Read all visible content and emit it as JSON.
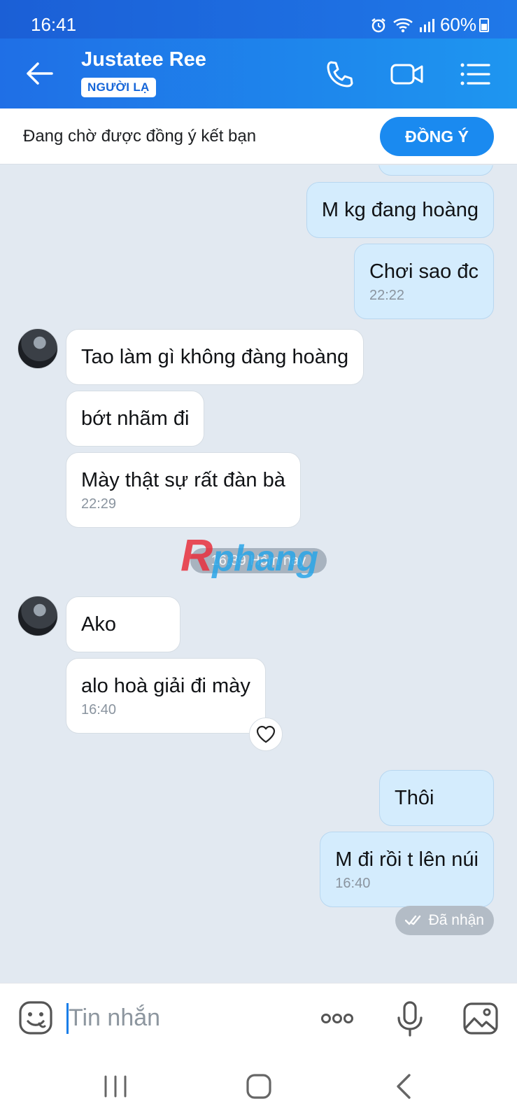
{
  "status_bar": {
    "time": "16:41",
    "battery": "60%"
  },
  "header": {
    "contact_name": "Justatee Ree",
    "badge": "NGƯỜI LẠ"
  },
  "friend_request": {
    "text": "Đang chờ được đồng ý kết bạn",
    "accept_label": "ĐỒNG Ý"
  },
  "messages": {
    "m1": {
      "text": "M kg đang hoàng"
    },
    "m2": {
      "text": "Chơi sao đc",
      "time": "22:22"
    },
    "m3": {
      "text": "Tao làm gì không đàng hoàng"
    },
    "m4": {
      "text": "bớt nhãm đi"
    },
    "m5": {
      "text": "Mày thật sự rất đàn bà",
      "time": "22:29"
    },
    "m6": {
      "text": "Ako"
    },
    "m7": {
      "text": "alo hoà giải đi mày",
      "time": "16:40"
    },
    "m8": {
      "text": "Thôi"
    },
    "m9": {
      "text": "M đi rồi t lên núi",
      "time": "16:40"
    }
  },
  "date_separator": "16:39 Hôm nay",
  "watermark": {
    "first": "R",
    "rest": "phang"
  },
  "receipt": {
    "label": "Đã nhận"
  },
  "composer": {
    "placeholder": "Tin nhắn"
  },
  "colors": {
    "header": "#1f78e8",
    "accent": "#1a8af0",
    "outgoing_bubble": "#d4ecfd",
    "incoming_bubble": "#ffffff",
    "chat_bg": "#e2e9f1"
  }
}
